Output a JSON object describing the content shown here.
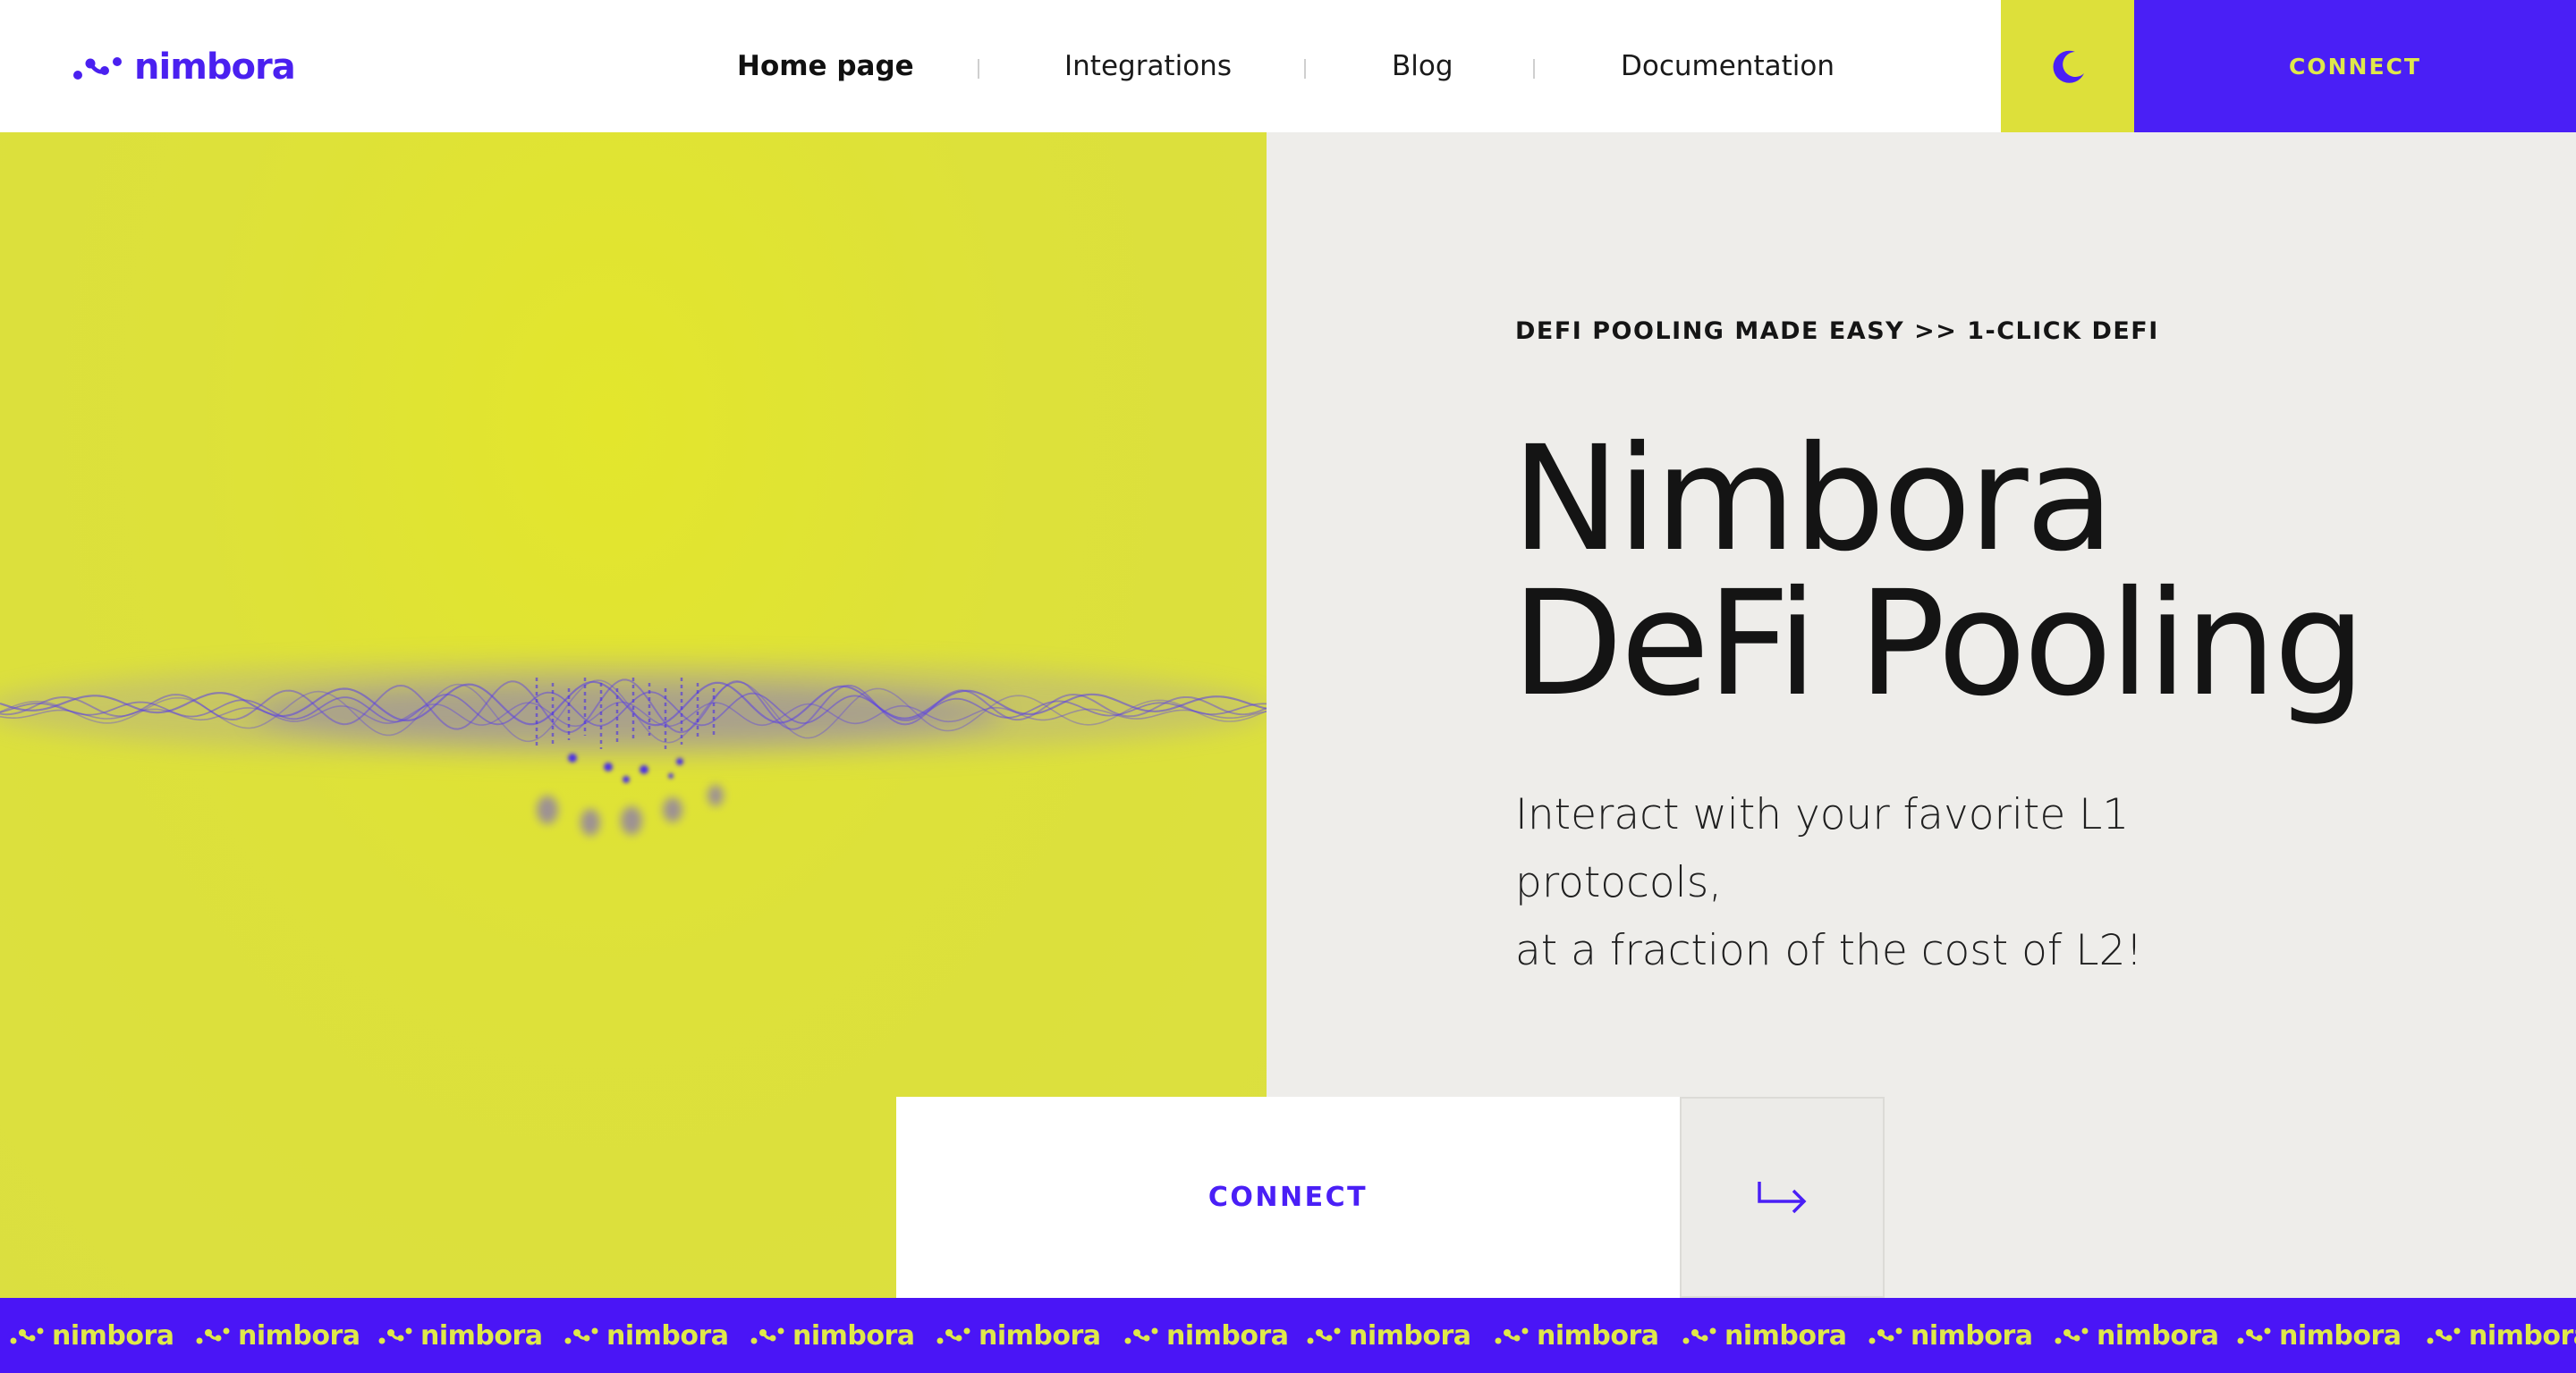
{
  "brand": {
    "name": "nimbora",
    "primary_color": "#4a1ff6",
    "accent_color": "#dde03a",
    "logo_icon": "nimbora-dots-icon"
  },
  "nav": {
    "items": [
      {
        "label": "Home page",
        "active": true
      },
      {
        "label": "Integrations",
        "active": false
      },
      {
        "label": "Blog",
        "active": false
      },
      {
        "label": "Documentation",
        "active": false
      }
    ]
  },
  "header": {
    "theme_toggle_icon": "moon-icon",
    "connect_label": "CONNECT"
  },
  "hero": {
    "eyebrow": "DEFI POOLING MADE EASY >> 1-CLICK DEFI",
    "title_line1": "Nimbora",
    "title_line2": "DeFi Pooling",
    "subtitle_line1": "Interact with your favorite L1 protocols,",
    "subtitle_line2": "at a fraction of the cost of L2!",
    "visual": "purple-wave-visual"
  },
  "cta": {
    "connect_label": "CONNECT",
    "arrow_icon": "arrow-right-hook-icon"
  },
  "marquee": {
    "items": [
      "nimbora",
      "nimbora",
      "nimbora",
      "nimbora",
      "nimbora",
      "nimbora",
      "nimbora",
      "nimbora",
      "nimbora",
      "nimbora",
      "nimbora",
      "nimbora",
      "nimbora",
      "nimbora"
    ]
  }
}
